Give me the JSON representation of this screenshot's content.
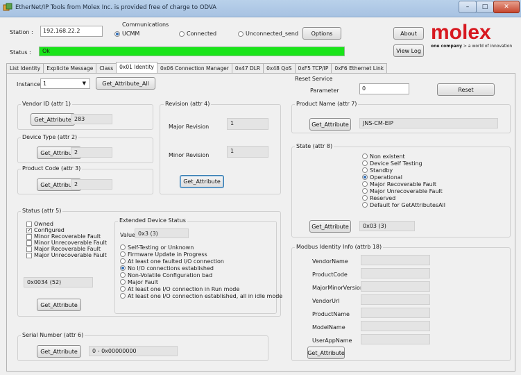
{
  "window": {
    "title": "EtherNet/IP Tools from Molex Inc. is provided free of charge to ODVA",
    "minimize": "–",
    "maximize": "□",
    "close": "✕"
  },
  "header": {
    "station_label": "Station :",
    "station_value": "192.168.22.2",
    "communications_label": "Communications",
    "comm_options": [
      "UCMM",
      "Connected",
      "Unconnected_send"
    ],
    "options_button": "Options",
    "about_button": "About",
    "viewlog_button": "View Log",
    "status_label": "Status :",
    "status_value": "Ok",
    "status_color": "#19e419",
    "logo_text": "molex",
    "logo_tagline_bold": "one company",
    "logo_tagline_rest": " > a world of innovation",
    "logo_color": "#d71920"
  },
  "tabs": [
    "List Identity",
    "Explicite Message",
    "Class",
    "0x01 Identity",
    "0x06 Connection Manager",
    "0x47 DLR",
    "0x48 QoS",
    "0xF5 TCP/IP",
    "0xF6 Ethernet Link"
  ],
  "identity": {
    "instance_label": "Instance",
    "instance_value": "1",
    "get_all_button": "Get_Attribute_All",
    "get_attribute": "Get_Attribute",
    "vendor": {
      "title": "Vendor ID (attr 1)",
      "value": "283"
    },
    "device_type": {
      "title": "Device Type (attr 2)",
      "value": "2"
    },
    "product_code": {
      "title": "Product Code (attr 3)",
      "value": "2"
    },
    "revision": {
      "title": "Revision (attr 4)",
      "major_label": "Major Revision",
      "major_value": "1",
      "minor_label": "Minor Revision",
      "minor_value": "1"
    },
    "status": {
      "title": "Status (attr 5)",
      "checks": [
        "Owned",
        "Configured",
        "Minor Recoverable Fault",
        "Minor Unrecoverable Fault",
        "Major Recoverable Fault",
        "Major Unrecoverable Fault"
      ],
      "value": "0x0034 (52)"
    },
    "extended": {
      "title": "Extended Device Status",
      "value_label": "Value",
      "value": "0x3 (3)",
      "options": [
        "Self-Testing or Unknown",
        "Firmware Update in Progress",
        "At least one faulted I/O connection",
        "No I/O connections established",
        "Non-Volatile Configuration bad",
        "Major Fault",
        "At least one I/O connection in Run mode",
        "At least one I/O connection established, all in idle mode"
      ]
    },
    "serial": {
      "title": "Serial Number (attr 6)",
      "value": "0 - 0x00000000"
    }
  },
  "reset_service": {
    "title": "Reset Service",
    "parameter_label": "Parameter",
    "parameter_value": "0",
    "reset_button": "Reset"
  },
  "product_name": {
    "title": "Product Name (attr 7)",
    "value": "JNS-CM-EIP"
  },
  "state": {
    "title": "State (attr 8)",
    "options": [
      "Non existent",
      "Device Self Testing",
      "Standby",
      "Operational",
      "Major Recoverable Fault",
      "Major Unrecoverable Fault",
      "Reserved",
      "Default for GetAttributesAll"
    ],
    "value": "0x03 (3)"
  },
  "modbus": {
    "title": "Modbus Identity Info (attrb 18)",
    "fields": [
      "VendorName",
      "ProductCode",
      "MajorMinorVersion",
      "VendorUrl",
      "ProductName",
      "ModelName",
      "UserAppName"
    ]
  }
}
